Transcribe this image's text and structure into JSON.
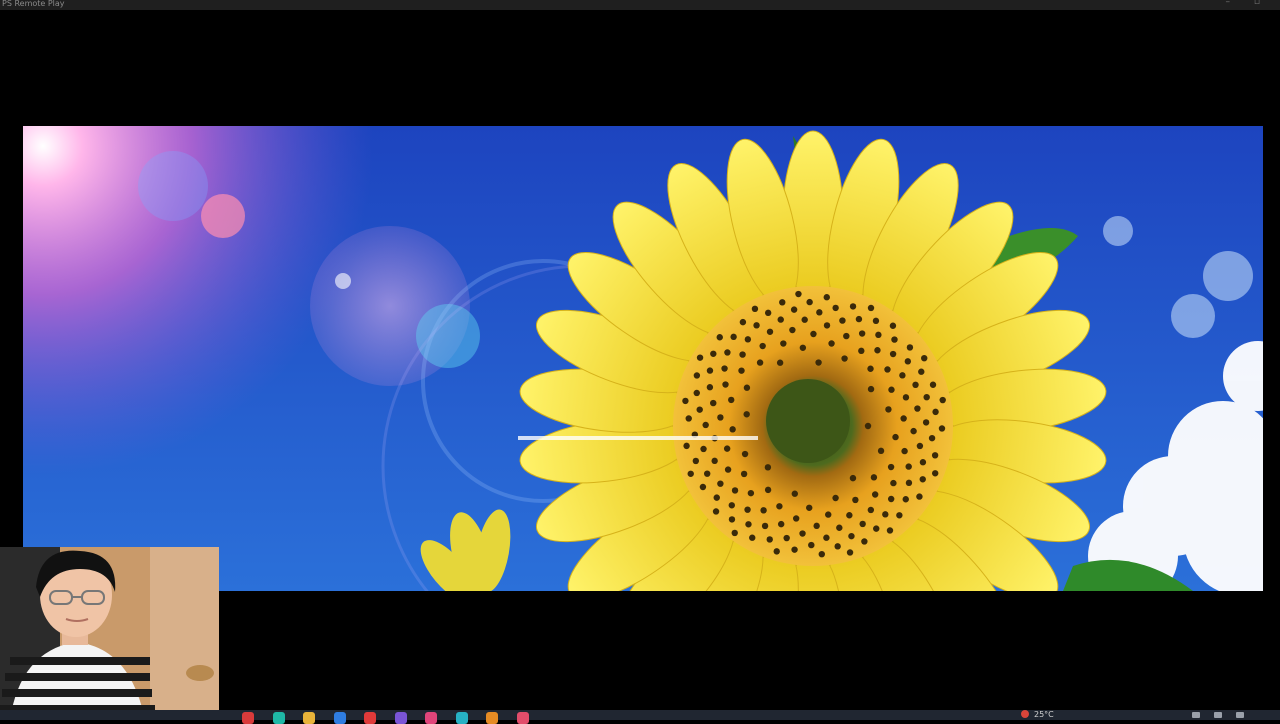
{
  "window": {
    "title": "PS Remote Play",
    "minimize_glyph": "–",
    "maximize_glyph": "▫"
  },
  "game_view": {
    "scene": "sunflower-sky-cutscene",
    "colors": {
      "sky_top": "#1f49c4",
      "sky_bottom": "#2a6fd8",
      "petal": "#f7e43a",
      "seed_disk": "#e7a11e",
      "center": "#3e5a1a"
    }
  },
  "webcam": {
    "colors": {
      "wall": "#c99a6a",
      "shirt_stripe": "#1a1a1a"
    }
  },
  "taskbar": {
    "icons": [
      {
        "name": "start-icon",
        "color": "#d93b3b"
      },
      {
        "name": "edge-icon",
        "color": "#1fb8a7"
      },
      {
        "name": "folder-icon",
        "color": "#e8b33a"
      },
      {
        "name": "store-icon",
        "color": "#2f7de1"
      },
      {
        "name": "app-red-icon",
        "color": "#e03a3a"
      },
      {
        "name": "app-purple-icon",
        "color": "#7a55d6"
      },
      {
        "name": "app-pink-icon",
        "color": "#e0457a"
      },
      {
        "name": "app-teal-icon",
        "color": "#27b1c4"
      },
      {
        "name": "app-orange-icon",
        "color": "#e58b24"
      },
      {
        "name": "remote-play-icon",
        "color": "#e24d6b"
      }
    ],
    "weather_temp": "25°C"
  }
}
